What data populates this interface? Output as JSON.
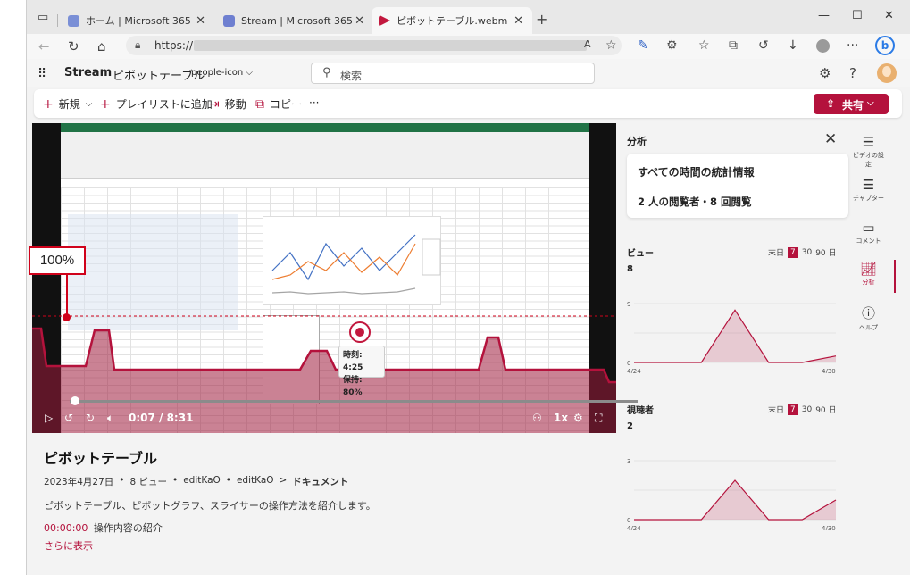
{
  "tabs": [
    {
      "label": "ホーム | Microsoft 365"
    },
    {
      "label": "Stream | Microsoft 365"
    },
    {
      "label": "ピボットテーブル.webm"
    }
  ],
  "address": {
    "url_prefix": "https://"
  },
  "app": {
    "brand": "Stream",
    "doc_title": "ピボットテーブル",
    "title_icon": "people-icon ⌵",
    "search_placeholder": "検索"
  },
  "commands": {
    "new": "新規",
    "add_playlist": "プレイリストに追加",
    "move": "移動",
    "copy": "コピー",
    "more": "···",
    "share": "共有"
  },
  "colors": {
    "accent": "#b4123c",
    "video_fill": "#9e1b3d"
  },
  "video": {
    "callout_percent": "100%",
    "tooltip_time": "時刻: 4:25",
    "tooltip_retention": "保持: 80%",
    "time": "0:07 / 8:31",
    "speed": "1x"
  },
  "details": {
    "title": "ピボットテーブル",
    "date": "2023年4月27日",
    "views": "8 ビュー",
    "owner": "editKaO",
    "path_owner": "editKaO",
    "folder": "ドキュメント",
    "description": "ピボットテーブル、ピボットグラフ、スライサーの操作方法を紹介します。",
    "chapter_time": "00:00:00",
    "chapter_label": "操作内容の紹介",
    "show_more": "さらに表示"
  },
  "analytics": {
    "title": "分析",
    "card_title": "すべての時間の統計情報",
    "card_stats": "2 人の閲覧者・8 回閲覧",
    "views_label": "ビュー",
    "views_count": "8",
    "viewers_label": "視聴者",
    "viewers_count": "2",
    "range_options": [
      "末日",
      "7",
      "30",
      "90 日"
    ],
    "views_chart": {
      "ymax_label": "9",
      "ymin_label": "0",
      "x_start": "4/24",
      "x_end": "4/30",
      "values": [
        0,
        0,
        0,
        8,
        0,
        0,
        1
      ]
    },
    "viewers_chart": {
      "ymax_label": "3",
      "ymin_label": "0",
      "x_start": "4/24",
      "x_end": "4/30",
      "values": [
        0,
        0,
        0,
        2,
        0,
        0,
        1
      ]
    }
  },
  "rail": {
    "video_settings": "ビデオの設定",
    "chapters": "チャプター",
    "comments": "コメント",
    "analytics": "分析",
    "help": "ヘルプ"
  }
}
